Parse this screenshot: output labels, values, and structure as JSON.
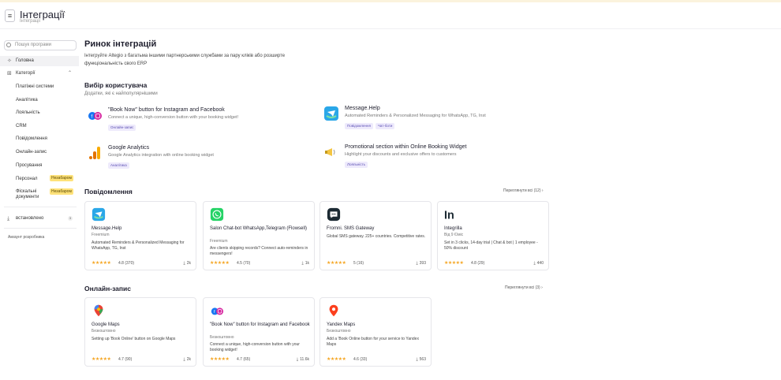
{
  "header": {
    "title": "Інтеграції",
    "subtitle": "Інтеграції"
  },
  "sidebar": {
    "search_placeholder": "Пошук програми",
    "home": "Головна",
    "categories": "Категорії",
    "subitems": [
      "Платіжні системи",
      "Аналітика",
      "Лояльність",
      "CRM",
      "Повідомлення",
      "Онлайн-запис",
      "Просування",
      "Персонал",
      "Фіскальні документи"
    ],
    "soon_badge": "Незабаром",
    "installed": "встановлено",
    "installed_count": "3",
    "dev_account": "Аккаунт розробника"
  },
  "main": {
    "title": "Ринок інтеграцій",
    "intro": "Інтегруйте Altegio з багатьма іншими партнерськими службами за пару кліків або розширте функціональність свого ERP",
    "picks_title": "Вибір користувача",
    "picks_sub": "Додатки, які є найпопулярнішими",
    "picks": [
      {
        "name": "\"Book Now\" button for Instagram and Facebook",
        "desc": "Connect a unique, high-conversion button with your booking widget!",
        "tags": [
          "Онлайн-запис"
        ]
      },
      {
        "name": "Message.Help",
        "desc": "Automated Reminders & Personalized Messaging for WhatsApp, TG, Inst",
        "tags": [
          "Повідомлення",
          "Чат-боти"
        ]
      },
      {
        "name": "Google Analytics",
        "desc": "Google Analytics integration with online booking widget",
        "tags": [
          "Аналітика"
        ]
      },
      {
        "name": "Promotional section within Online Booking Widget",
        "desc": "Highlight your discounts and exclusive offers to customers",
        "tags": [
          "Лояльність"
        ]
      }
    ],
    "messages_title": "Повідомлення",
    "messages_see_all": "Переглянути всі (12)",
    "messages": [
      {
        "name": "Message.Help",
        "price": "Freemium",
        "desc": "Automated Reminders & Personalized Messaging for WhatsApp, TG, Inst",
        "rating": "4.8 (370)",
        "installs": "2k"
      },
      {
        "name": "Salon Chat-bot WhatsApp,Telegram (Flowsell)",
        "price": "Freemium",
        "desc": "Are clients skipping records? Connect auto-reminders in messengers!",
        "rating": "4.5 (70)",
        "installs": "1k"
      },
      {
        "name": "Fromni. SMS Gateway",
        "price": "",
        "desc": "Global SMS gateway. 225+ countries. Competitive rates.",
        "rating": "5 (16)",
        "installs": "393"
      },
      {
        "name": "Integrilla",
        "price": "Від 9 €/міс",
        "desc": "Set in 3 clicks, 14-day trial | Chat & bot | 1 employee - 50% discount",
        "rating": "4.8 (29)",
        "installs": "440"
      }
    ],
    "booking_title": "Онлайн-запис",
    "booking_see_all": "Переглянути всі (3)",
    "booking": [
      {
        "name": "Google Maps",
        "price": "Безкоштовно",
        "desc": "Setting up 'Book Online' button on Google Maps",
        "rating": "4.7 (90)",
        "installs": "2k"
      },
      {
        "name": "\"Book Now\" button for Instagram and Facebook",
        "price": "Безкоштовно",
        "desc": "Connect a unique, high-conversion button with your booking widget!",
        "rating": "4.7 (65)",
        "installs": "11.6k"
      },
      {
        "name": "Yandex Maps",
        "price": "Безкоштовно",
        "desc": "Add a 'Book Online button for your service to Yandex Maps",
        "rating": "4.6 (33)",
        "installs": "563"
      }
    ]
  },
  "colors": {
    "accent": "#6b5bd6",
    "star": "#f5a623",
    "badge": "#ffe27a"
  }
}
